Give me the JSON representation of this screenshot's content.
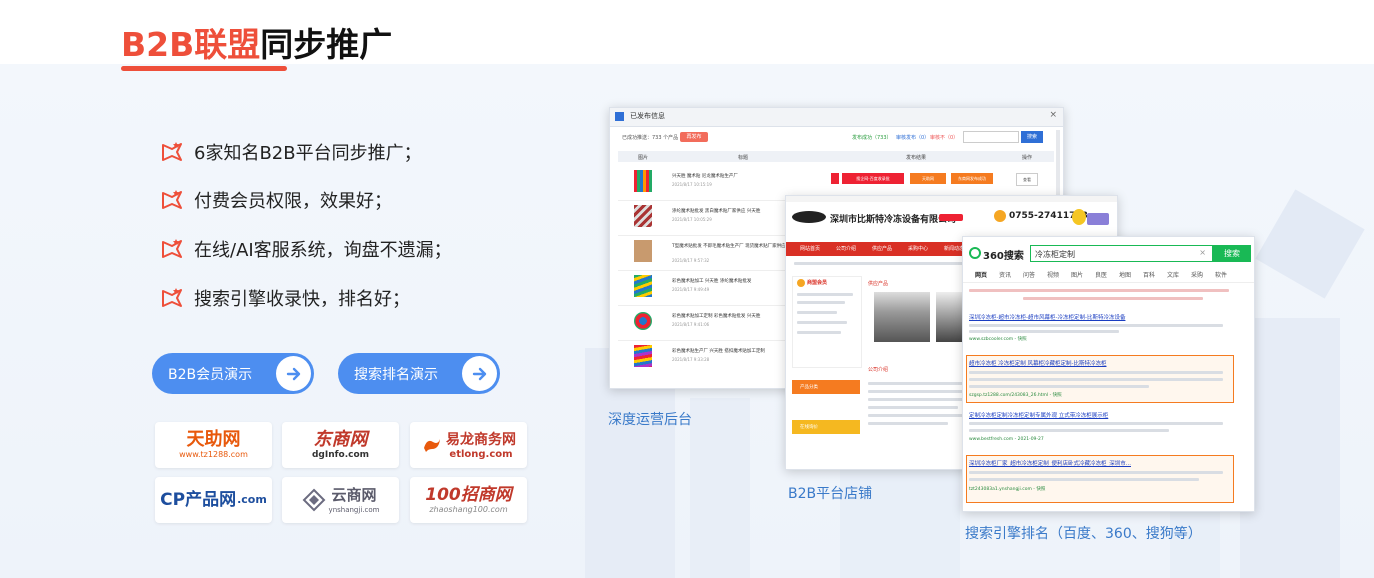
{
  "title": {
    "highlight": "B2B联盟",
    "rest": "同步推广"
  },
  "features": [
    "6家知名B2B平台同步推广；",
    "付费会员权限，效果好；",
    "在线/AI客服系统，询盘不遗漏；",
    "搜索引擎收录快，排名好；"
  ],
  "buttons": {
    "b2b_demo": "B2B会员演示",
    "search_demo": "搜索排名演示"
  },
  "logos": [
    {
      "main": "天助网",
      "sub": "www.tz1288.com",
      "color": "#e8590c"
    },
    {
      "main": "东商网",
      "sub": "dgInfo.com",
      "color": "#c0392b"
    },
    {
      "main": "易龙商务网",
      "sub": "etlong.com",
      "color": "#c0392b"
    },
    {
      "main": "CP产品网",
      "sub": ".com",
      "color": "#1d4e9e"
    },
    {
      "main": "云商网",
      "sub": "ynshangji.com",
      "color": "#5b5b6b"
    },
    {
      "main": "100招商网",
      "sub": "zhaoshang100.com",
      "color": "#c0392b"
    }
  ],
  "backend": {
    "window_title": "已发布信息",
    "filter_label": "已成功推送：733 个产品",
    "filter_button": "再发布",
    "stats": [
      "发布成功（733）",
      "审核发布（0）",
      "审核不（0）"
    ],
    "search_button": "搜索",
    "columns": [
      "图片",
      "标题",
      "发布结果",
      "操作"
    ],
    "rows": [
      {
        "title": "兴天胜 魔术贴 尼龙魔术贴生产厂",
        "date": "2021/8/17 10:15:19"
      },
      {
        "title": "涤纶魔术贴批发 黑白魔术贴厂家供应 兴天胜",
        "date": "2021/8/17 10:05:29"
      },
      {
        "title": "T型魔术贴批发 不即毛魔术贴生产厂 现货魔术贴厂家供应",
        "date": "2021/8/17 9:57:32"
      },
      {
        "title": "彩色魔术贴加工 兴天胜 涤纶魔术贴批发",
        "date": "2021/8/17 9:49:49"
      },
      {
        "title": "彩色魔术贴加工定制 彩色魔术贴批发 兴天胜",
        "date": "2021/8/17 9:41:06"
      },
      {
        "title": "彩色魔术贴生产厂 兴天胜 搭扣魔术贴加工定制",
        "date": "2021/8/17 9:33:28"
      }
    ],
    "result_labels": [
      "搜企网-百度收录批",
      "天助网",
      "东商网发布成功"
    ],
    "op_label": "查看"
  },
  "store": {
    "company": "深圳市比斯特冷冻设备有限公司",
    "phone": "0755-27411753",
    "nav": [
      "网站首页",
      "公司介绍",
      "供应产品",
      "采购中心",
      "新闻动态"
    ],
    "side_title": "商盟会员",
    "products_title": "供应产品",
    "company_intro": "公司介绍",
    "side_menu": [
      "产品分类",
      "在线询价"
    ]
  },
  "search": {
    "brand": "360搜索",
    "query": "冷冻柜定制",
    "button": "搜索",
    "tabs": [
      "网页",
      "资讯",
      "问答",
      "视频",
      "图片",
      "良医",
      "地图",
      "百科",
      "文库",
      "采购",
      "软件"
    ],
    "results": [
      {
        "title": "深圳冷冻柜-超市冷冻柜-超市风幕柜-冷冻柜定制-比斯特冷冻设备",
        "url": "www.szbcooler.com - 快照",
        "highlight": false
      },
      {
        "title": "超市冷冻柜 冷冻柜定制 风幕柜冷藏柜定制-比斯特冷冻柜",
        "url": "szgsp.tz1288.com/243083_26.html - 快照",
        "highlight": true
      },
      {
        "title": "定制冷冻柜定制冷冻柜定制专属外观 立式带冷冻柜展示柜",
        "url": "www.bestfresh.com - 2021-09-27",
        "highlight": false
      },
      {
        "title": "深圳冷冻柜厂家_超市冷冻柜定制_便利店卧式冷藏冷冻柜_深圳市...",
        "url": "tzt243083a1.ynshangji.com - 快照",
        "highlight": true
      }
    ]
  },
  "captions": {
    "backend": "深度运营后台",
    "store": "B2B平台店铺",
    "search": "搜索引擎排名（百度、360、搜狗等）"
  },
  "colors": {
    "accent": "#ee4f3a",
    "button": "#4d8ef0",
    "caption": "#3a7ac9",
    "search_green": "#19b955"
  }
}
